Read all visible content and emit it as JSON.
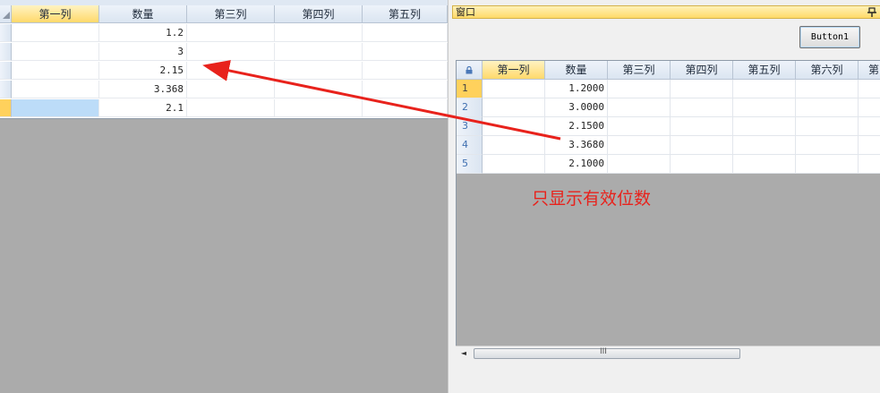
{
  "left_grid": {
    "columns": [
      "第一列",
      "数量",
      "第三列",
      "第四列",
      "第五列"
    ],
    "rows": [
      {
        "col1": "",
        "qty": "1.2"
      },
      {
        "col1": "",
        "qty": "3"
      },
      {
        "col1": "",
        "qty": "2.15"
      },
      {
        "col1": "",
        "qty": "3.368"
      },
      {
        "col1": "",
        "qty": "2.1"
      }
    ]
  },
  "window": {
    "title": "窗口",
    "pin_icon": "pin-icon",
    "button_label": "Button1",
    "grid": {
      "corner_icon": "lock-icon",
      "columns": [
        "第一列",
        "数量",
        "第三列",
        "第四列",
        "第五列",
        "第六列",
        "第"
      ],
      "row_numbers": [
        "1",
        "2",
        "3",
        "4",
        "5"
      ],
      "qty_values": [
        "1.2000",
        "3.0000",
        "2.1500",
        "3.3680",
        "2.1000"
      ]
    },
    "scrollbar": {
      "left_arrow": "◄",
      "grip": "III"
    }
  },
  "annotation": {
    "text": "只显示有效位数",
    "color": "#e8221c"
  },
  "colors": {
    "header_active": "#ffd96b",
    "selection": "#bcdcf8",
    "empty_area": "#ababab"
  }
}
